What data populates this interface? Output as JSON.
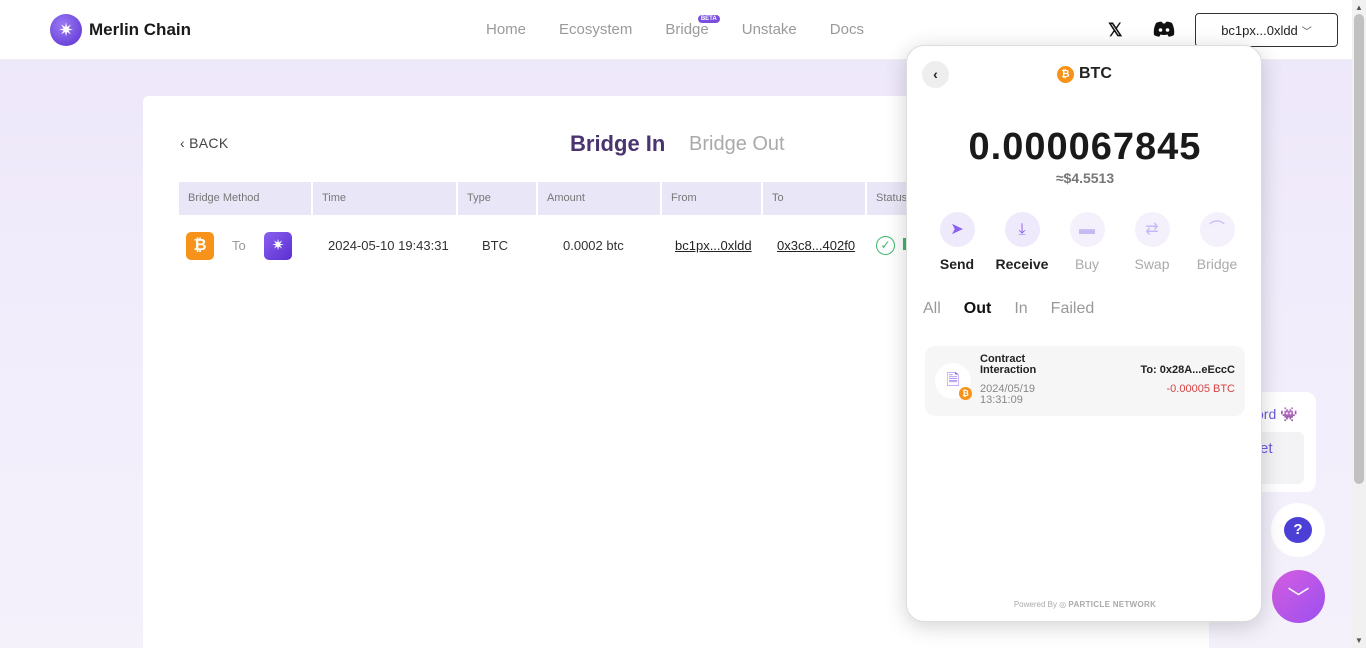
{
  "header": {
    "logo_text": "Merlin Chain",
    "nav": [
      {
        "label": "Home"
      },
      {
        "label": "Ecosystem"
      },
      {
        "label": "Bridge",
        "badge": "BETA"
      },
      {
        "label": "Unstake"
      },
      {
        "label": "Docs"
      }
    ],
    "x_icon": "𝕏",
    "wallet_address": "bc1px...0xldd"
  },
  "bridge": {
    "back_label": "BACK",
    "tab_in": "Bridge In",
    "tab_out": "Bridge Out",
    "columns": [
      "Bridge Method",
      "Time",
      "Type",
      "Amount",
      "From",
      "To",
      "Status"
    ],
    "row": {
      "to_label": "To",
      "time": "2024-05-10 19:43:31",
      "type": "BTC",
      "amount": "0.0002 btc",
      "from": "bc1px...0xldd",
      "to": "0x3c8...402f0"
    }
  },
  "side": {
    "discord_text": "ord",
    "inner_text": "et"
  },
  "wallet_popup": {
    "token": "BTC",
    "balance": "0.000067845",
    "usd_value": "≈$4.5513",
    "actions": [
      {
        "label": "Send",
        "icon": "send-icon"
      },
      {
        "label": "Receive",
        "icon": "download-icon"
      },
      {
        "label": "Buy",
        "icon": "card-icon"
      },
      {
        "label": "Swap",
        "icon": "swap-icon"
      },
      {
        "label": "Bridge",
        "icon": "bridge-icon"
      }
    ],
    "filters": [
      "All",
      "Out",
      "In",
      "Failed"
    ],
    "active_filter": "Out",
    "transaction": {
      "type": "Contract Interaction",
      "time": "2024/05/19 13:31:09",
      "to": "To: 0x28A...eEccC",
      "amount": "-0.00005 BTC"
    },
    "powered_by": "Powered By",
    "powered_brand": "PARTICLE NETWORK"
  },
  "colors": {
    "accent": "#8b5ff0",
    "btc": "#f7931a",
    "success": "#3bb86a",
    "negative": "#d64545"
  }
}
